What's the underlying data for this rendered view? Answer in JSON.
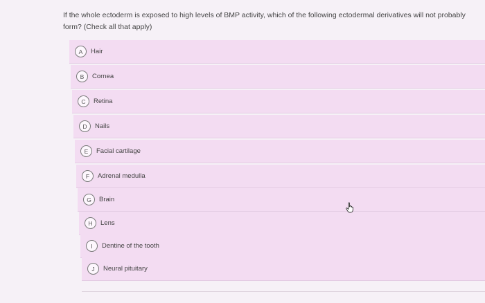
{
  "question": {
    "text": "If the whole ectoderm is exposed to high levels of BMP activity, which of the following ectodermal derivatives will not probably form? (Check all that apply)"
  },
  "options": [
    {
      "letter": "A",
      "label": "Hair"
    },
    {
      "letter": "B",
      "label": "Cornea"
    },
    {
      "letter": "C",
      "label": "Retina"
    },
    {
      "letter": "D",
      "label": "Nails"
    },
    {
      "letter": "E",
      "label": "Facial cartilage"
    },
    {
      "letter": "F",
      "label": "Adrenal medulla"
    },
    {
      "letter": "G",
      "label": "Brain"
    },
    {
      "letter": "H",
      "label": "Lens"
    },
    {
      "letter": "I",
      "label": "Dentine of the tooth"
    },
    {
      "letter": "J",
      "label": "Neural pituitary"
    }
  ],
  "icons": {
    "cursor": "hand-pointer-icon"
  }
}
